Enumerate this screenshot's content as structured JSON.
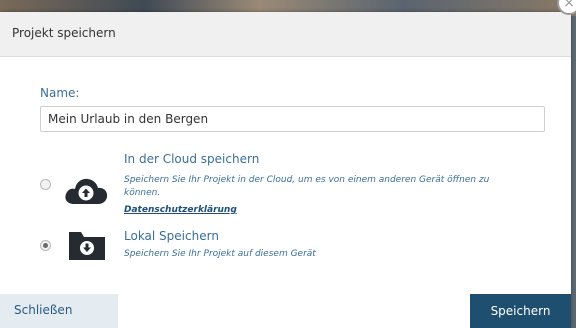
{
  "dialog": {
    "title": "Projekt speichern",
    "close_glyph": "×"
  },
  "name": {
    "label": "Name:",
    "value": "Mein Urlaub in den Bergen"
  },
  "options": [
    {
      "title": "In der Cloud speichern",
      "description": "Speichern Sie Ihr Projekt in der Cloud, um es von einem anderen Gerät öffnen zu können.",
      "link": "Datenschutzerklärung",
      "icon": "cloud-upload-icon",
      "selected": false
    },
    {
      "title": "Lokal Speichern",
      "description": "Speichern Sie Ihr Projekt auf diesem Gerät",
      "icon": "folder-download-icon",
      "selected": true
    }
  ],
  "footer": {
    "close_label": "Schließen",
    "save_label": "Speichern"
  },
  "colors": {
    "accent_text": "#3a6f9a",
    "primary_button": "#1f4f6e",
    "icon_dark": "#252b31"
  }
}
